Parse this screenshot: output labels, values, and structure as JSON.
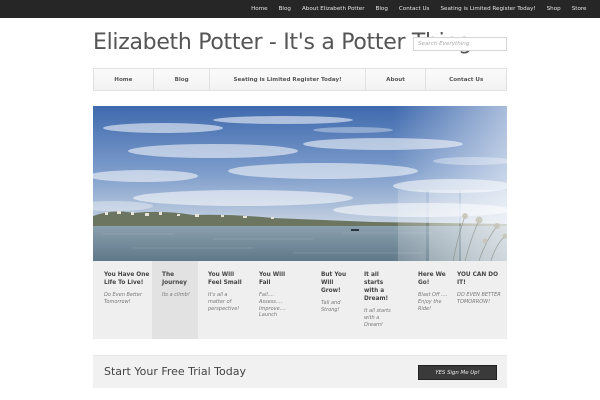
{
  "topnav": [
    "Home",
    "Blog",
    "About Elizabeth Potter",
    "Blog",
    "Contact Us",
    "Seating is Limited Register Today!",
    "Shop",
    "Store"
  ],
  "site": {
    "title": "Elizabeth Potter - It's a Potter Thing",
    "search_placeholder": "Search Everything"
  },
  "mainnav": [
    "Home",
    "Blog",
    "Seating is Limited Register Today!",
    "About",
    "Contact Us"
  ],
  "slides": [
    {
      "title": "You Have One Life To Live!",
      "subtitle": "Do Even Better Tomorrow!"
    },
    {
      "title": "The Journey",
      "subtitle": "Its a climb!"
    },
    {
      "title": "You Will Feel Small",
      "subtitle": "It's all a matter of perspective!"
    },
    {
      "title": "You Will Fail",
      "subtitle": "Fail.... Assess.... Improve.... Launch"
    },
    {
      "title": "But You Will Grow!",
      "subtitle": "Tall and Strong!"
    },
    {
      "title": "It all starts with a Dream!",
      "subtitle": "It all starts with a Dream!"
    },
    {
      "title": "Here We Go!",
      "subtitle": "Blast Off .... Enjoy the Ride!"
    },
    {
      "title": "YOU CAN DO IT!",
      "subtitle": "DO EVEN BETTER TOMORROW!"
    }
  ],
  "cta": {
    "title": "Start Your Free Trial Today",
    "button": "YES Sign Me Up!"
  },
  "colors": {
    "topbar": "#262626",
    "sky": "#4f78b5",
    "water": "#7f93a3",
    "button": "#3a3a3a"
  }
}
